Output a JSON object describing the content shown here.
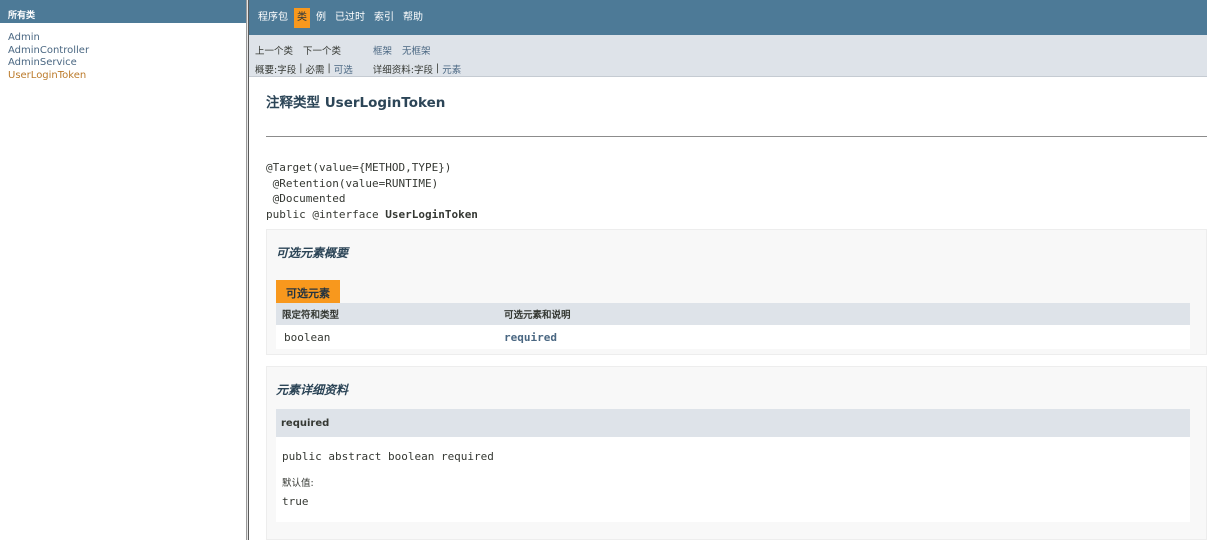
{
  "left": {
    "header": "所有类",
    "classes": [
      "Admin",
      "AdminController",
      "AdminService",
      "UserLoginToken"
    ]
  },
  "top_nav": {
    "items": [
      "程序包",
      "类",
      "例",
      "已过时",
      "索引",
      "帮助"
    ],
    "active_index": 1
  },
  "sub_nav": {
    "prev_class": "上一个类",
    "next_class": "下一个类",
    "frames": "框架",
    "no_frames": "无框架",
    "summary_label": "概要: ",
    "summary_field": "字段",
    "sep": " | ",
    "summary_required": "必需",
    "summary_optional": "可选",
    "detail_label": "详细资料: ",
    "detail_field": "字段",
    "detail_element": "元素"
  },
  "page_title": "注释类型 UserLoginToken",
  "signature": {
    "line1": "@Target(value={METHOD,TYPE})",
    "line2": " @Retention(value=RUNTIME)",
    "line3": " @Documented",
    "line4_prefix": "public @interface ",
    "line4_name": "UserLoginToken"
  },
  "summary": {
    "title": "可选元素概要",
    "tab": "可选元素",
    "col1_header": "限定符和类型",
    "col2_header": "可选元素和说明",
    "rows": [
      {
        "type": "boolean",
        "name": "required"
      }
    ]
  },
  "detail": {
    "title": "元素详细资料",
    "element_name": "required",
    "element_signature": "public abstract boolean required",
    "default_label": "默认值:",
    "default_value": "true"
  },
  "colors": {
    "nav_bar": "#4d7a97",
    "active_tab": "#f8981d",
    "sub_nav": "#dee3e9",
    "link": "#4a6782",
    "current_link": "#bb7a2a"
  }
}
